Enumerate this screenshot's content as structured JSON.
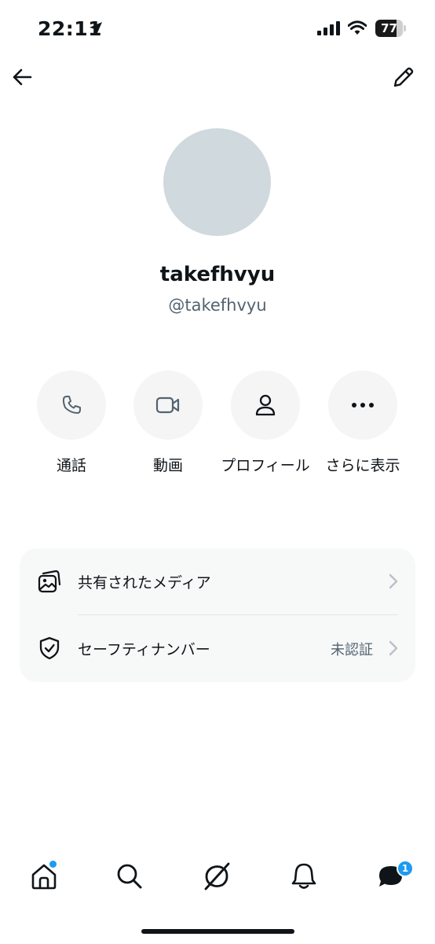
{
  "status_bar": {
    "time": "22:11",
    "battery": "77",
    "battery_level": 0.77
  },
  "header": {
    "back_icon": "arrow-left-icon",
    "edit_icon": "pencil-icon"
  },
  "profile": {
    "display_name": "takefhvyu",
    "handle": "@takefhvyu"
  },
  "actions": [
    {
      "label": "通話",
      "icon": "phone-icon"
    },
    {
      "label": "動画",
      "icon": "video-icon"
    },
    {
      "label": "プロフィール",
      "icon": "person-icon"
    },
    {
      "label": "さらに表示",
      "icon": "more-icon"
    }
  ],
  "settings": [
    {
      "label": "共有されたメディア",
      "value": "",
      "icon": "media-icon"
    },
    {
      "label": "セーフティナンバー",
      "value": "未認証",
      "icon": "shield-check-icon"
    }
  ],
  "bottom_nav": {
    "items": [
      "home-icon",
      "search-icon",
      "grok-icon",
      "bell-icon",
      "messages-icon"
    ],
    "messages_badge": "1"
  },
  "colors": {
    "accent": "#1d9bf0",
    "secondary_text": "#536471",
    "avatar": "#cfd9de"
  }
}
